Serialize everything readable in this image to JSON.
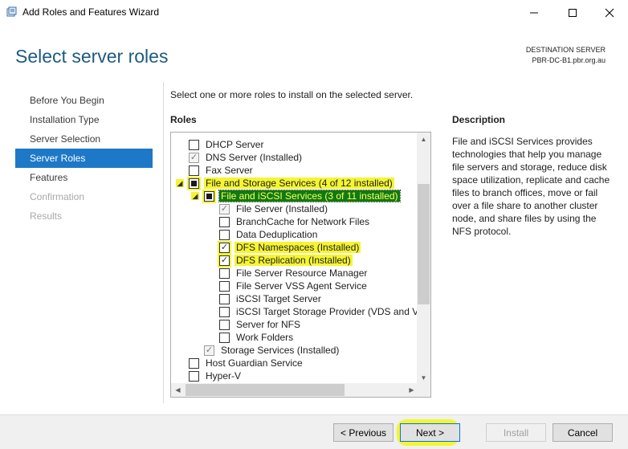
{
  "window": {
    "title": "Add Roles and Features Wizard"
  },
  "header": {
    "page_title": "Select server roles",
    "destination_label": "DESTINATION SERVER",
    "destination_server": "PBR-DC-B1.pbr.org.au"
  },
  "nav": {
    "items": [
      {
        "label": "Before You Begin",
        "state": "normal"
      },
      {
        "label": "Installation Type",
        "state": "normal"
      },
      {
        "label": "Server Selection",
        "state": "normal"
      },
      {
        "label": "Server Roles",
        "state": "active"
      },
      {
        "label": "Features",
        "state": "normal"
      },
      {
        "label": "Confirmation",
        "state": "disabled"
      },
      {
        "label": "Results",
        "state": "disabled"
      }
    ]
  },
  "main": {
    "intro": "Select one or more roles to install on the selected server.",
    "roles_label": "Roles",
    "roles": [
      {
        "label": "DHCP Server",
        "check": "unchecked"
      },
      {
        "label": "DNS Server (Installed)",
        "check": "checked-grey"
      },
      {
        "label": "Fax Server",
        "check": "unchecked"
      },
      {
        "label": "File and Storage Services (4 of 12 installed)",
        "check": "partial",
        "expanded": true,
        "highlight": "yellow"
      },
      {
        "label": "File and iSCSI Services (3 of 11 installed)",
        "check": "partial",
        "expanded": true,
        "highlight": "selected"
      },
      {
        "label": "File Server (Installed)",
        "check": "checked-grey"
      },
      {
        "label": "BranchCache for Network Files",
        "check": "unchecked"
      },
      {
        "label": "Data Deduplication",
        "check": "unchecked"
      },
      {
        "label": "DFS Namespaces (Installed)",
        "check": "checked",
        "highlight": "yellow"
      },
      {
        "label": "DFS Replication (Installed)",
        "check": "checked",
        "highlight": "yellow"
      },
      {
        "label": "File Server Resource Manager",
        "check": "unchecked"
      },
      {
        "label": "File Server VSS Agent Service",
        "check": "unchecked"
      },
      {
        "label": "iSCSI Target Server",
        "check": "unchecked"
      },
      {
        "label": "iSCSI Target Storage Provider (VDS and VSS",
        "check": "unchecked"
      },
      {
        "label": "Server for NFS",
        "check": "unchecked"
      },
      {
        "label": "Work Folders",
        "check": "unchecked"
      },
      {
        "label": "Storage Services (Installed)",
        "check": "checked-grey"
      },
      {
        "label": "Host Guardian Service",
        "check": "unchecked"
      },
      {
        "label": "Hyper-V",
        "check": "unchecked"
      }
    ],
    "description_label": "Description",
    "description": "File and iSCSI Services provides technologies that help you manage file servers and storage, reduce disk space utilization, replicate and cache files to branch offices, move or fail over a file share to another cluster node, and share files by using the NFS protocol."
  },
  "footer": {
    "previous_label": "< Previous",
    "next_label": "Next >",
    "install_label": "Install",
    "cancel_label": "Cancel"
  },
  "colors": {
    "accent": "#1e78c8",
    "title": "#1e5b80",
    "highlight": "#f5f532",
    "selected_bg": "#0f7a0f"
  }
}
